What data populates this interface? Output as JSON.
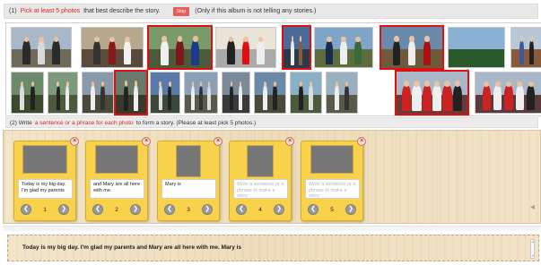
{
  "instructions": {
    "line1_prefix": "(1)",
    "line1_highlight": "Pick at least 5 photos",
    "line1_rest": "that best describe the story.",
    "skip_label": "Skip",
    "skip_note": "(Only if this album is not telling any stories.)",
    "line2_prefix": "(2) Write",
    "line2_highlight": "a sentence or a phrase for each photo",
    "line2_rest": "to form a story. (Please at least pick 5 photos.)"
  },
  "album": {
    "photos": [
      {
        "id": 1,
        "selected": false
      },
      {
        "id": 2,
        "selected": false
      },
      {
        "id": 3,
        "selected": true
      },
      {
        "id": 4,
        "selected": false
      },
      {
        "id": 5,
        "selected": true
      },
      {
        "id": 6,
        "selected": false
      },
      {
        "id": 7,
        "selected": true
      },
      {
        "id": 8,
        "selected": false
      },
      {
        "id": 9,
        "selected": false
      },
      {
        "id": 10,
        "selected": false
      },
      {
        "id": 11,
        "selected": false
      },
      {
        "id": 12,
        "selected": false
      },
      {
        "id": 13,
        "selected": true
      },
      {
        "id": 14,
        "selected": false
      },
      {
        "id": 15,
        "selected": false
      },
      {
        "id": 16,
        "selected": false
      },
      {
        "id": 17,
        "selected": false
      },
      {
        "id": 18,
        "selected": false
      },
      {
        "id": 19,
        "selected": false
      },
      {
        "id": 20,
        "selected": true
      },
      {
        "id": 21,
        "selected": false
      }
    ]
  },
  "cards": [
    {
      "text": "Today is my big day. I'm glad my parents",
      "placeholder": "",
      "number": "1",
      "close_icon": "×"
    },
    {
      "text": "and Mary are all here with me.",
      "placeholder": "",
      "number": "2",
      "close_icon": "×"
    },
    {
      "text": "Mary is",
      "placeholder": "",
      "number": "3",
      "close_icon": "×"
    },
    {
      "text": "",
      "placeholder": "Write a sentence or a phrase to make a story",
      "number": "4",
      "close_icon": "×"
    },
    {
      "text": "",
      "placeholder": "Write a sentence or a phrase to make a story",
      "number": "5",
      "close_icon": "×"
    }
  ],
  "nav": {
    "prev_icon": "❮",
    "next_icon": "❯"
  },
  "story": {
    "text": "Today is my big day. I'm glad my parents and Mary are all here with me. Mary is"
  },
  "colors": {
    "accent_red": "#e02020",
    "card_yellow": "#f7d24a",
    "selected_border": "#e01010"
  }
}
